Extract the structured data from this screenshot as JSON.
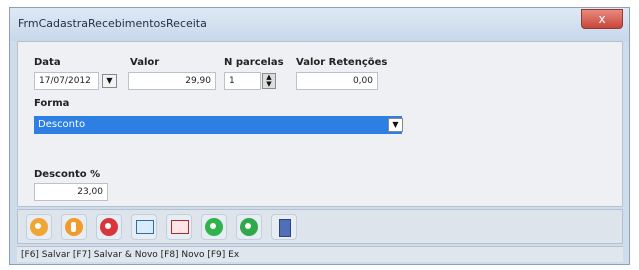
{
  "window": {
    "title": "FrmCadastraRecebimentosReceita",
    "close_label": "x"
  },
  "form": {
    "labels": {
      "data": "Data",
      "valor": "Valor",
      "parcelas": "N parcelas",
      "retencoes": "Valor Retenções",
      "forma": "Forma",
      "desconto": "Desconto %"
    },
    "values": {
      "data": "17/07/2012",
      "valor": "29,90",
      "parcelas": "1",
      "retencoes": "0,00",
      "forma": "Desconto",
      "desconto": "23,00"
    }
  },
  "icons": {
    "dropdown": "dropdown-arrow-icon",
    "spin": "spin-arrows-icon"
  },
  "toolbar": {
    "buttons": [
      {
        "name": "orange-circle-icon"
      },
      {
        "name": "clock-orange-icon"
      },
      {
        "name": "red-circle-icon"
      },
      {
        "name": "window-arrow-icon"
      },
      {
        "name": "window-arrow-red-icon"
      },
      {
        "name": "green-back-icon"
      },
      {
        "name": "green-forward-icon"
      },
      {
        "name": "exit-door-icon"
      }
    ]
  },
  "status": {
    "text": "[F6] Salvar [F7] Salvar & Novo [F8] Novo [F9] Ex"
  }
}
